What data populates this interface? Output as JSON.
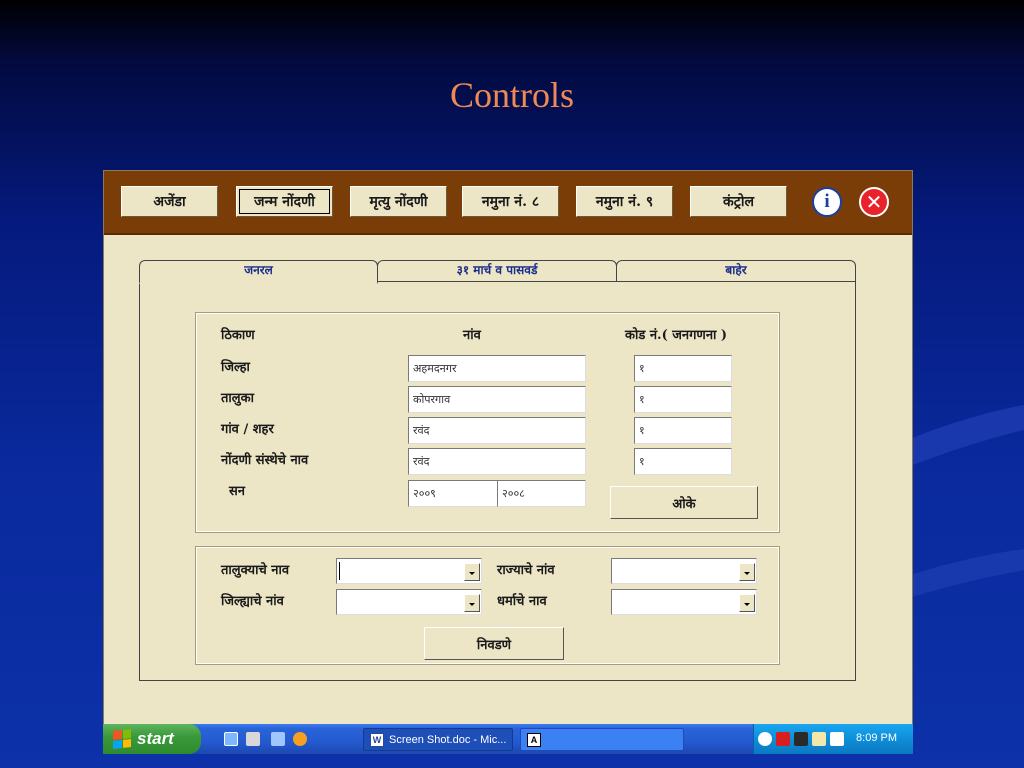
{
  "slide_title": "Controls",
  "toolbar": {
    "buttons": [
      {
        "label": "अजेंडा"
      },
      {
        "label": "जन्म नोंदणी"
      },
      {
        "label": "मृत्यु नोंदणी"
      },
      {
        "label": "नमुना नं. ८"
      },
      {
        "label": "नमुना नं. ९"
      },
      {
        "label": "कंट्रोल"
      }
    ],
    "active_index": 1,
    "info_icon": "i",
    "close_icon": "✕"
  },
  "tabs": [
    {
      "label": "जनरल",
      "active": true
    },
    {
      "label": "३१ मार्च व पासवर्ड",
      "active": false
    },
    {
      "label": "बाहेर",
      "active": false
    }
  ],
  "general": {
    "headers": {
      "place": "ठिकाण",
      "name": "नांव",
      "code": "कोड नं.( जनगणना )"
    },
    "rows": [
      {
        "label": "जिल्हा",
        "name": "अहमदनगर",
        "code": "१"
      },
      {
        "label": "तालुका",
        "name": "कोपरगाव",
        "code": "१"
      },
      {
        "label": "गांव / शहर",
        "name": "रवंद",
        "code": "१"
      },
      {
        "label": "नोंदणी संस्थेचे नाव",
        "name": "रवंद",
        "code": "१"
      }
    ],
    "year": {
      "label": "सन",
      "from": "२००९",
      "to": "२००८"
    },
    "ok_label": "ओके"
  },
  "lookup": {
    "taluka_label": "तालुक्याचे नाव",
    "state_label": "राज्याचे नांव",
    "district_label": "जिल्ह्याचे नांव",
    "religion_label": "धर्माचे नाव",
    "select_label": "निवडणे"
  },
  "taskbar": {
    "start_label": "start",
    "task_button": "Screen Shot.doc - Mic...",
    "task_icon": "W",
    "ime_label": "A",
    "clock": "8:09 PM"
  }
}
